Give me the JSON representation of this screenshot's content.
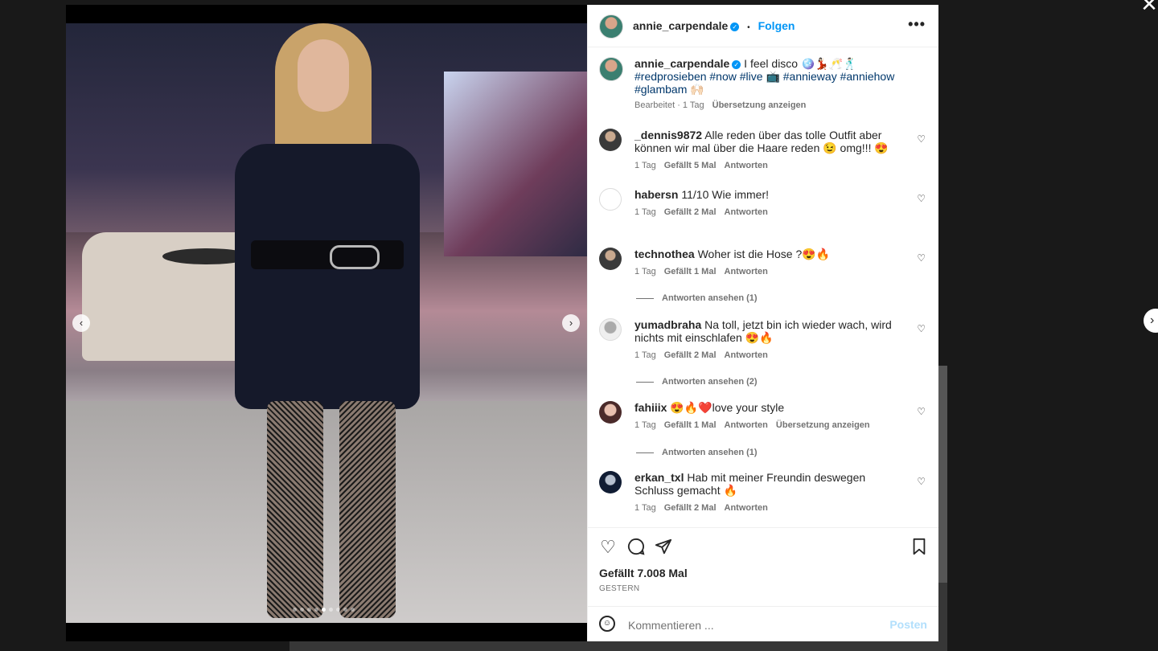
{
  "post": {
    "author": "annie_carpendale",
    "follow_label": "Folgen",
    "separator": "•",
    "more_label": "•••",
    "caption_user": "annie_carpendale",
    "caption_text": "I feel disco 🪩💃🏻🥂🕺🏻",
    "caption_tags": "#redprosieben #now #live 📺 #annieway #anniehow #glambam 🙌🏻",
    "caption_meta_edited": "Bearbeitet · 1 Tag",
    "caption_translate": "Übersetzung anzeigen",
    "likes": "Gefällt 7.008 Mal",
    "date": "GESTERN"
  },
  "comments": [
    {
      "user": "_dennis9872",
      "text": "Alle reden über das tolle Outfit aber können wir mal über die Haare reden 😉 omg!!! 😍",
      "time": "1 Tag",
      "likes": "Gefällt 5 Mal",
      "reply": "Antworten"
    },
    {
      "user": "habersn",
      "text": "11/10 Wie immer!",
      "time": "1 Tag",
      "likes": "Gefällt 2 Mal",
      "reply": "Antworten"
    },
    {
      "user": "technothea",
      "text": "Woher ist die Hose ?😍🔥",
      "time": "1 Tag",
      "likes": "Gefällt 1 Mal",
      "reply": "Antworten",
      "view_replies": "Antworten ansehen (1)"
    },
    {
      "user": "yumadbraha",
      "text": "Na toll, jetzt bin ich wieder wach, wird nichts mit einschlafen 😍🔥",
      "time": "1 Tag",
      "likes": "Gefällt 2 Mal",
      "reply": "Antworten",
      "view_replies": "Antworten ansehen (2)"
    },
    {
      "user": "fahiiix",
      "text": "😍🔥❤️love your style",
      "time": "1 Tag",
      "likes": "Gefällt 1 Mal",
      "reply": "Antworten",
      "translate": "Übersetzung anzeigen",
      "view_replies": "Antworten ansehen (1)"
    },
    {
      "user": "erkan_txl",
      "text": "Hab mit meiner Freundin deswegen Schluss gemacht 🔥",
      "time": "1 Tag",
      "likes": "Gefällt 2 Mal",
      "reply": "Antworten"
    }
  ],
  "composer": {
    "placeholder": "Kommentieren ...",
    "post_label": "Posten"
  },
  "icons": {
    "close": "close-icon",
    "like": "heart-icon",
    "comment": "comment-icon",
    "share": "share-icon",
    "save": "bookmark-icon",
    "emoji": "emoji-icon"
  },
  "carousel": {
    "total": 9,
    "active_index": 4
  },
  "colors": {
    "accent": "#0095f6",
    "text": "#262626",
    "muted": "#737373",
    "verified": "#0095f6"
  }
}
